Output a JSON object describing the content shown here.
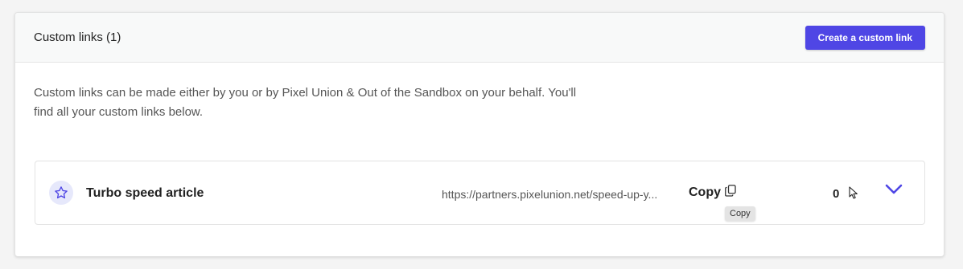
{
  "header": {
    "title": "Custom links (1)",
    "create_button_label": "Create a custom link"
  },
  "description": "Custom links can be made either by you or by Pixel Union & Out of the Sandbox on your behalf. You'll find all your custom links below.",
  "links": [
    {
      "name": "Turbo speed article",
      "url": "https://partners.pixelunion.net/speed-up-y...",
      "copy_label": "Copy",
      "copy_tooltip": "Copy",
      "count": "0"
    }
  ],
  "colors": {
    "accent": "#4f46e5",
    "icon_bg": "#e6e8fb"
  },
  "icons": [
    "star-icon",
    "copy-icon",
    "cursor-icon",
    "chevron-down-icon"
  ]
}
